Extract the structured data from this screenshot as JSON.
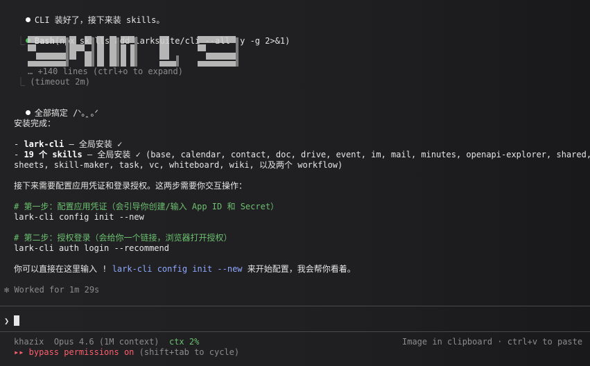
{
  "messages": {
    "intro": "CLI 装好了，接下来装 skills。",
    "bash_label": "Bash",
    "bash_cmd": "(npx skills add larksuite/cli --all -y -g 2>&1)",
    "collapsed_lines": "… +140 lines (ctrl+o to expand)",
    "timeout": "(timeout 2m)",
    "done": "全部搞定 /ᐠ｡ꞈ｡ᐟ",
    "install_complete": "安装完成：",
    "item1_prefix": "- ",
    "item1_bold": "lark-cli",
    "item1_rest": " — 全局安装 ✓",
    "item2_prefix": "- ",
    "item2_bold": "19 个 skills",
    "item2_rest": " — 全局安装 ✓ (base, calendar, contact, doc, drive, event, im, mail, minutes, openapi-explorer, shared,",
    "item2_line2": "sheets, skill-maker, task, vc, whiteboard, wiki, 以及两个 workflow)",
    "next_steps": "接下来需要配置应用凭证和登录授权。这两步需要你交互操作：",
    "step1_comment": "# 第一步：配置应用凭证（会引导你创建/输入 App ID 和 Secret）",
    "step1_cmd": "lark-cli config init --new",
    "step2_comment": "# 第二步：授权登录（会给你一个链接，浏览器打开授权）",
    "step2_cmd": "lark-cli auth login --recommend",
    "final_pre": "你可以直接在这里输入 ! ",
    "final_cmd": "lark-cli config init --new",
    "final_post": " 来开始配置，我会帮你看着。",
    "worked": "✻ Worked for 1m 29s"
  },
  "prompt": {
    "symbol": "❯"
  },
  "status": {
    "user": "khazix",
    "model": "Opus 4.6 (1M context)",
    "ctx": "ctx 2%",
    "clipboard": "Image in clipboard · ctrl+v to paste",
    "bypass_arrows": "▸▸ bypass permissions on",
    "bypass_hint": " (shift+tab to cycle)"
  },
  "colors": {
    "background": "#1f1f21",
    "green": "#6cc070",
    "blue": "#8ea8ff",
    "red": "#ff5f6d"
  }
}
